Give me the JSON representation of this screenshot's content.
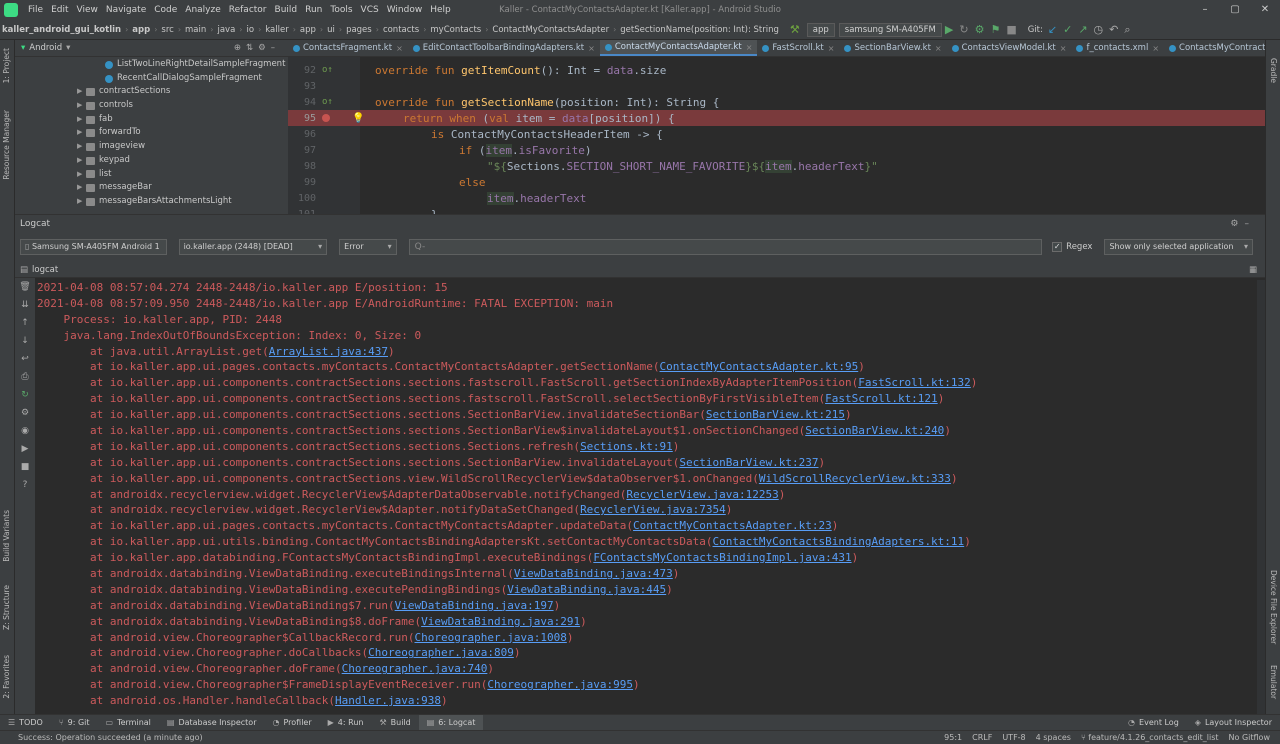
{
  "window": {
    "title": "Kaller - ContactMyContactsAdapter.kt [Kaller.app] - Android Studio",
    "menu": [
      "File",
      "Edit",
      "View",
      "Navigate",
      "Code",
      "Analyze",
      "Refactor",
      "Build",
      "Run",
      "Tools",
      "VCS",
      "Window",
      "Help"
    ],
    "controls": [
      "–",
      "▢",
      "✕"
    ]
  },
  "navbar": {
    "breadcrumbs": [
      "kaller_android_gui_kotlin",
      "app",
      "src",
      "main",
      "java",
      "io",
      "kaller",
      "app",
      "ui",
      "pages",
      "contacts",
      "myContacts",
      "ContactMyContactsAdapter",
      "getSectionName(position: Int): String"
    ],
    "run_config": "app",
    "device": "samsung SM-A405FM",
    "git_label": "Git:"
  },
  "left_strip": {
    "project": "1: Project",
    "resource_manager": "Resource Manager",
    "build_variants": "Build Variants",
    "structure": "Z: Structure",
    "favorites": "2: Favorites"
  },
  "right_strip": {
    "gradle": "Gradle",
    "device_file_explorer": "Device File Explorer",
    "emulator": "Emulator"
  },
  "project": {
    "header": "Android",
    "tree": [
      {
        "label": "ListTwoLineRightDetailSampleFragment",
        "type": "class",
        "indent": 3
      },
      {
        "label": "RecentCallDialogSampleFragment",
        "type": "class",
        "indent": 3
      },
      {
        "label": "contractSections",
        "type": "folder",
        "indent": 2
      },
      {
        "label": "controls",
        "type": "folder",
        "indent": 2
      },
      {
        "label": "fab",
        "type": "folder",
        "indent": 2
      },
      {
        "label": "forwardTo",
        "type": "folder",
        "indent": 2
      },
      {
        "label": "imageview",
        "type": "folder",
        "indent": 2
      },
      {
        "label": "keypad",
        "type": "folder",
        "indent": 2
      },
      {
        "label": "list",
        "type": "folder",
        "indent": 2
      },
      {
        "label": "messageBar",
        "type": "folder",
        "indent": 2
      },
      {
        "label": "messageBarsAttachmentsLight",
        "type": "folder",
        "indent": 2
      }
    ]
  },
  "editor": {
    "tabs": [
      {
        "label": "ContactsFragment.kt",
        "active": false
      },
      {
        "label": "EditContactToolbarBindingAdapters.kt",
        "active": false
      },
      {
        "label": "ContactMyContactsAdapter.kt",
        "active": true
      },
      {
        "label": "FastScroll.kt",
        "active": false
      },
      {
        "label": "SectionBarView.kt",
        "active": false
      },
      {
        "label": "ContactsViewModel.kt",
        "active": false
      },
      {
        "label": "f_contacts.xml",
        "active": false
      },
      {
        "label": "ContactsMyContractViewModel.kt",
        "active": false
      }
    ],
    "line_numbers": [
      "92",
      "93",
      "94",
      "95",
      "96",
      "97",
      "98",
      "99",
      "100",
      "101"
    ],
    "code": {
      "l92": {
        "kw": "override fun ",
        "fn": "getItemCount",
        "rest1": "(): Int = ",
        "pp": "data",
        "rest2": ".size"
      },
      "l94": {
        "kw": "override fun ",
        "fn": "getSectionName",
        "rest1": "(position: Int): String {"
      },
      "l95": {
        "kw1": "return when ",
        "rest1": "(",
        "kw2": "val ",
        "rest2": "item = ",
        "pp": "data",
        "rest3": "[position]) {"
      },
      "l96": {
        "kw": "is ",
        "rest1": "ContactMyContactsHeaderItem -> {"
      },
      "l97": {
        "kw": "if ",
        "rest1": "(",
        "hl": "item",
        "rest2": ".",
        "pp": "isFavorite",
        "rest3": ")"
      },
      "l98": {
        "st1": "\"${",
        "rest1": "Sections.",
        "pp": "SECTION_SHORT_NAME_FAVORITE",
        "st2": "}${",
        "hl": "item",
        "rest2": ".",
        "pp2": "headerText",
        "st3": "}\""
      },
      "l99": {
        "kw": "else"
      },
      "l100": {
        "hl": "item",
        "rest1": ".",
        "pp": "headerText"
      },
      "l101": {
        "rest1": "}"
      }
    }
  },
  "logcat": {
    "title": "Logcat",
    "device_select": "Samsung SM-A405FM Android 1",
    "process_select": "io.kaller.app (2448) [DEAD]",
    "level_select": "Error",
    "search_placeholder": "Q-",
    "regex_label": "Regex",
    "regex_checked": "✓",
    "filter_select": "Show only selected application",
    "subheader": "logcat",
    "lines": [
      {
        "indent": "",
        "text": "2021-04-08 08:57:04.274 2448-2448/io.kaller.app E/position: 15",
        "link": "",
        "tail": ""
      },
      {
        "indent": "",
        "text": "2021-04-08 08:57:09.950 2448-2448/io.kaller.app E/AndroidRuntime: FATAL EXCEPTION: main",
        "link": "",
        "tail": ""
      },
      {
        "indent": "    ",
        "text": "Process: io.kaller.app, PID: 2448",
        "link": "",
        "tail": ""
      },
      {
        "indent": "    ",
        "text": "java.lang.IndexOutOfBoundsException: Index: 0, Size: 0",
        "link": "",
        "tail": ""
      },
      {
        "indent": "        ",
        "text": "at java.util.ArrayList.get(",
        "link": "ArrayList.java:437",
        "tail": ")"
      },
      {
        "indent": "        ",
        "text": "at io.kaller.app.ui.pages.contacts.myContacts.ContactMyContactsAdapter.getSectionName(",
        "link": "ContactMyContactsAdapter.kt:95",
        "tail": ")"
      },
      {
        "indent": "        ",
        "text": "at io.kaller.app.ui.components.contractSections.sections.fastscroll.FastScroll.getSectionIndexByAdapterItemPosition(",
        "link": "FastScroll.kt:132",
        "tail": ")"
      },
      {
        "indent": "        ",
        "text": "at io.kaller.app.ui.components.contractSections.sections.fastscroll.FastScroll.selectSectionByFirstVisibleItem(",
        "link": "FastScroll.kt:121",
        "tail": ")"
      },
      {
        "indent": "        ",
        "text": "at io.kaller.app.ui.components.contractSections.sections.SectionBarView.invalidateSectionBar(",
        "link": "SectionBarView.kt:215",
        "tail": ")"
      },
      {
        "indent": "        ",
        "text": "at io.kaller.app.ui.components.contractSections.sections.SectionBarView$invalidateLayout$1.onSectionChanged(",
        "link": "SectionBarView.kt:240",
        "tail": ")"
      },
      {
        "indent": "        ",
        "text": "at io.kaller.app.ui.components.contractSections.sections.Sections.refresh(",
        "link": "Sections.kt:91",
        "tail": ")"
      },
      {
        "indent": "        ",
        "text": "at io.kaller.app.ui.components.contractSections.sections.SectionBarView.invalidateLayout(",
        "link": "SectionBarView.kt:237",
        "tail": ")"
      },
      {
        "indent": "        ",
        "text": "at io.kaller.app.ui.components.contractSections.view.WildScrollRecyclerView$dataObserver$1.onChanged(",
        "link": "WildScrollRecyclerView.kt:333",
        "tail": ")"
      },
      {
        "indent": "        ",
        "text": "at androidx.recyclerview.widget.RecyclerView$AdapterDataObservable.notifyChanged(",
        "link": "RecyclerView.java:12253",
        "tail": ")"
      },
      {
        "indent": "        ",
        "text": "at androidx.recyclerview.widget.RecyclerView$Adapter.notifyDataSetChanged(",
        "link": "RecyclerView.java:7354",
        "tail": ")"
      },
      {
        "indent": "        ",
        "text": "at io.kaller.app.ui.pages.contacts.myContacts.ContactMyContactsAdapter.updateData(",
        "link": "ContactMyContactsAdapter.kt:23",
        "tail": ")"
      },
      {
        "indent": "        ",
        "text": "at io.kaller.app.ui.utils.binding.ContactMyContactsBindingAdaptersKt.setContactMyContactsData(",
        "link": "ContactMyContactsBindingAdapters.kt:11",
        "tail": ")"
      },
      {
        "indent": "        ",
        "text": "at io.kaller.app.databinding.FContactsMyContactsBindingImpl.executeBindings(",
        "link": "FContactsMyContactsBindingImpl.java:431",
        "tail": ")"
      },
      {
        "indent": "        ",
        "text": "at androidx.databinding.ViewDataBinding.executeBindingsInternal(",
        "link": "ViewDataBinding.java:473",
        "tail": ")"
      },
      {
        "indent": "        ",
        "text": "at androidx.databinding.ViewDataBinding.executePendingBindings(",
        "link": "ViewDataBinding.java:445",
        "tail": ")"
      },
      {
        "indent": "        ",
        "text": "at androidx.databinding.ViewDataBinding$7.run(",
        "link": "ViewDataBinding.java:197",
        "tail": ")"
      },
      {
        "indent": "        ",
        "text": "at androidx.databinding.ViewDataBinding$8.doFrame(",
        "link": "ViewDataBinding.java:291",
        "tail": ")"
      },
      {
        "indent": "        ",
        "text": "at android.view.Choreographer$CallbackRecord.run(",
        "link": "Choreographer.java:1008",
        "tail": ")"
      },
      {
        "indent": "        ",
        "text": "at android.view.Choreographer.doCallbacks(",
        "link": "Choreographer.java:809",
        "tail": ")"
      },
      {
        "indent": "        ",
        "text": "at android.view.Choreographer.doFrame(",
        "link": "Choreographer.java:740",
        "tail": ")"
      },
      {
        "indent": "        ",
        "text": "at android.view.Choreographer$FrameDisplayEventReceiver.run(",
        "link": "Choreographer.java:995",
        "tail": ")"
      },
      {
        "indent": "        ",
        "text": "at android.os.Handler.handleCallback(",
        "link": "Handler.java:938",
        "tail": ")"
      }
    ]
  },
  "bottom_tabs": [
    {
      "icon": "☰",
      "label": "TODO",
      "active": false
    },
    {
      "icon": "⑂",
      "label": "9: Git",
      "active": false
    },
    {
      "icon": "▭",
      "label": "Terminal",
      "active": false
    },
    {
      "icon": "▤",
      "label": "Database Inspector",
      "active": false
    },
    {
      "icon": "◔",
      "label": "Profiler",
      "active": false
    },
    {
      "icon": "▶",
      "label": "4: Run",
      "active": false
    },
    {
      "icon": "⚒",
      "label": "Build",
      "active": false
    },
    {
      "icon": "▤",
      "label": "6: Logcat",
      "active": true
    }
  ],
  "bottom_right_tabs": [
    {
      "icon": "◔",
      "label": "Event Log"
    },
    {
      "icon": "◈",
      "label": "Layout Inspector"
    }
  ],
  "status": {
    "message": "Success: Operation succeeded (a minute ago)",
    "position": "95:1",
    "line_sep": "CRLF",
    "encoding": "UTF-8",
    "indent": "4 spaces",
    "branch": "feature/4.1.26_contacts_edit_list",
    "flow": "No Gitflow"
  }
}
